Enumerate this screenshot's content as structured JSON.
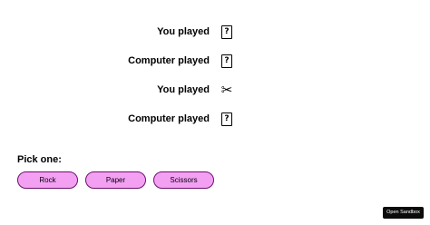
{
  "rounds": [
    {
      "label": "You played",
      "icon": "mystery-card-icon",
      "glyph": "?"
    },
    {
      "label": "Computer played",
      "icon": "mystery-card-icon",
      "glyph": "?"
    },
    {
      "label": "You played",
      "icon": "scissors-icon",
      "glyph": "✂"
    },
    {
      "label": "Computer played",
      "icon": "mystery-card-icon",
      "glyph": "?"
    }
  ],
  "pick": {
    "label": "Pick one:",
    "options": [
      "Rock",
      "Paper",
      "Scissors"
    ]
  },
  "sandbox": {
    "label": "Open Sandbox"
  },
  "colors": {
    "button_fill": "#f3a0f3",
    "button_border": "#6b106b",
    "sandbox_bg": "#0b0b0b"
  }
}
